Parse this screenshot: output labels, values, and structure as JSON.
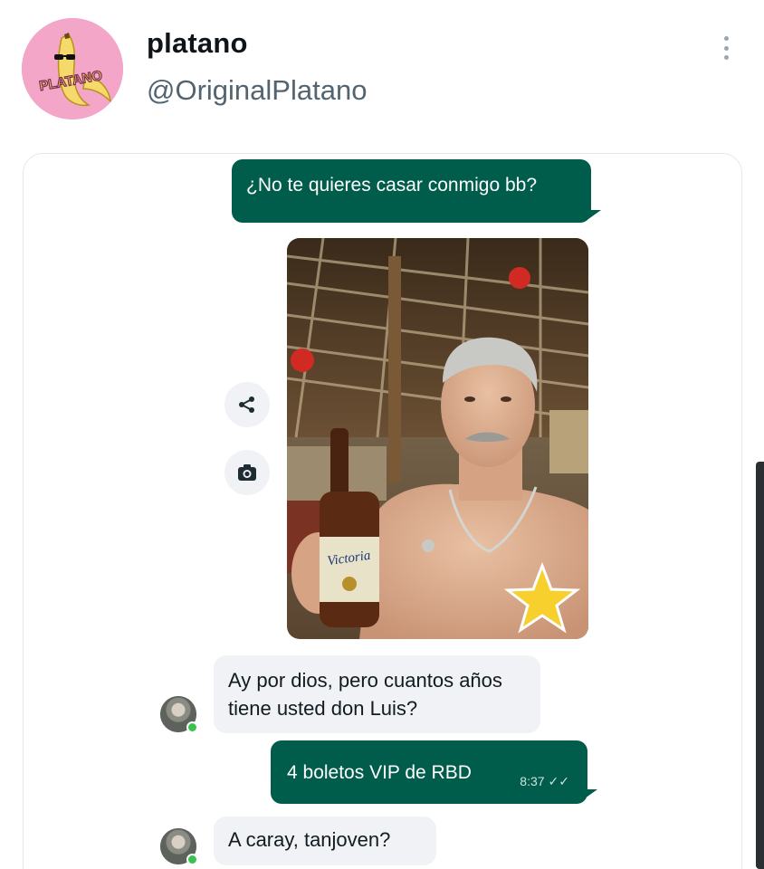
{
  "tweet": {
    "display_name": "platano",
    "handle": "@OriginalPlatano",
    "avatar_logo_text": "PLATANO",
    "more_icon": "more-vertical-icon"
  },
  "chat": {
    "messages": [
      {
        "direction": "outgoing",
        "text": "¿No te quieres casar conmigo bb?"
      },
      {
        "direction": "outgoing",
        "type": "photo",
        "beer_label": "Victoria"
      },
      {
        "direction": "incoming",
        "text": "Ay por dios, pero cuantos años tiene usted don Luis?"
      },
      {
        "direction": "outgoing",
        "text": "4 boletos VIP de RBD",
        "time": "8:37",
        "status_icon": "double-check-icon"
      },
      {
        "direction": "incoming",
        "text": "A caray, tanjoven?"
      }
    ],
    "side_actions": [
      "share-icon",
      "camera-icon"
    ],
    "colors": {
      "outgoing_bubble": "#005c4b",
      "incoming_bubble": "#f0f2f5",
      "online_dot": "#3ac251"
    }
  }
}
